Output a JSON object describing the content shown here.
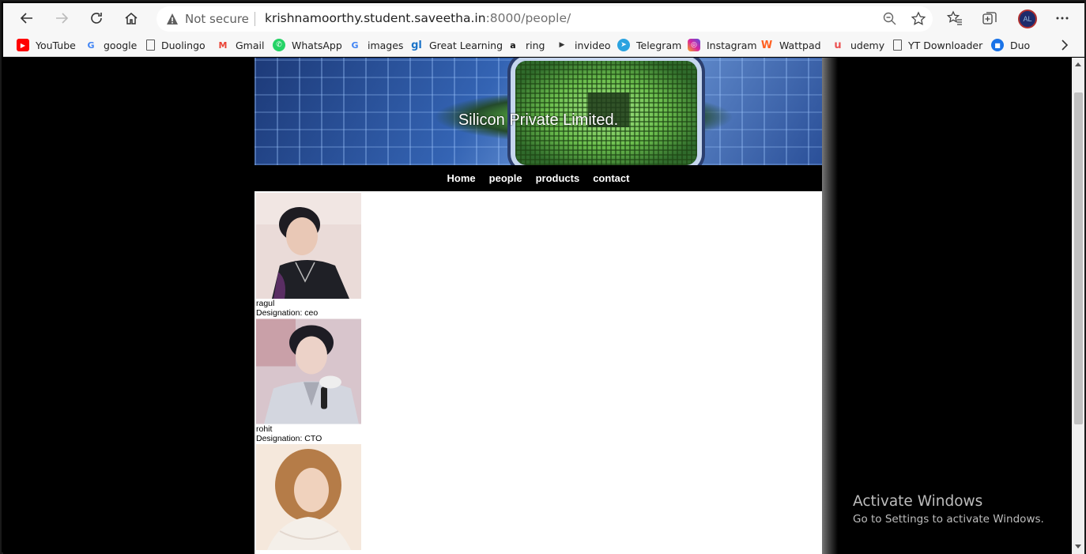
{
  "browser": {
    "security_label": "Not secure",
    "url_host": "krishnamoorthy.student.saveetha.in",
    "url_rest": ":8000/people/",
    "avatar_text": "AL"
  },
  "bookmarks": [
    {
      "label": "YouTube",
      "icon": "youtube-icon",
      "color": "#ff0000"
    },
    {
      "label": "google",
      "icon": "google-icon",
      "color": "#4285f4"
    },
    {
      "label": "Duolingo",
      "icon": "page-icon",
      "color": "#555555"
    },
    {
      "label": "Gmail",
      "icon": "gmail-icon",
      "color": "#ea4335"
    },
    {
      "label": "WhatsApp",
      "icon": "whatsapp-icon",
      "color": "#25d366"
    },
    {
      "label": "images",
      "icon": "google-icon",
      "color": "#4285f4"
    },
    {
      "label": "Great Learning",
      "icon": "greatlearning-icon",
      "color": "#1a73c8"
    },
    {
      "label": "ring",
      "icon": "amazon-icon",
      "color": "#ff9900"
    },
    {
      "label": "invideo",
      "icon": "invideo-icon",
      "color": "#333333"
    },
    {
      "label": "Telegram",
      "icon": "telegram-icon",
      "color": "#2aa3e0"
    },
    {
      "label": "Instagram",
      "icon": "instagram-icon",
      "color": "#d6249f"
    },
    {
      "label": "Wattpad",
      "icon": "wattpad-icon",
      "color": "#ff6122"
    },
    {
      "label": "udemy",
      "icon": "udemy-icon",
      "color": "#ec5252"
    },
    {
      "label": "YT Downloader",
      "icon": "page-icon",
      "color": "#555555"
    },
    {
      "label": "Duo",
      "icon": "duo-icon",
      "color": "#1a73e8"
    }
  ],
  "site": {
    "banner_title": "Silicon Private Limited.",
    "nav": [
      "Home",
      "people",
      "products",
      "contact"
    ]
  },
  "people": [
    {
      "name": "ragul",
      "designation": "Designation: ceo",
      "photo_colors": [
        "#e9d6d2",
        "#22232b"
      ]
    },
    {
      "name": "rohit",
      "designation": "Designation: CTO",
      "photo_colors": [
        "#d9c6cc",
        "#c9ccd6"
      ]
    },
    {
      "name": "",
      "designation": "",
      "photo_colors": [
        "#f4e6da",
        "#b07a4a"
      ]
    }
  ],
  "watermark": {
    "line1": "Activate Windows",
    "line2": "Go to Settings to activate Windows."
  }
}
